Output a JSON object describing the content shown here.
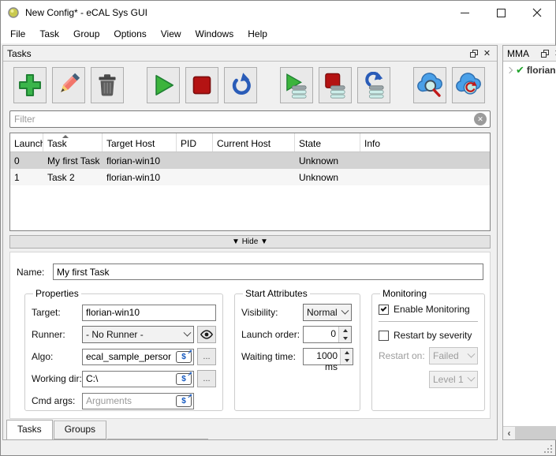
{
  "window": {
    "title": "New Config* - eCAL Sys GUI"
  },
  "menu": {
    "items": [
      "File",
      "Task",
      "Group",
      "Options",
      "View",
      "Windows",
      "Help"
    ]
  },
  "glyphs": {
    "close": "✕",
    "clear": "✕",
    "check_mark": "✔",
    "scroll_left": "‹",
    "scroll_right": "›",
    "dollar": "$",
    "arrow_ne": "↗"
  },
  "tasks_panel": {
    "title": "Tasks",
    "toolbar": {
      "buttons": [
        "add-task",
        "edit-task",
        "delete-task",
        "start-task",
        "stop-task",
        "restart-task",
        "start-all-tasks",
        "stop-all-tasks",
        "restart-all-tasks",
        "cloud-search",
        "cloud-reload"
      ]
    },
    "filter": {
      "placeholder": "Filter"
    },
    "table": {
      "columns": [
        "Launch",
        "Task",
        "Target Host",
        "PID",
        "Current Host",
        "State",
        "Info"
      ],
      "sort_column": "Task",
      "sort_order": "ascending",
      "rows": [
        {
          "launch": "0",
          "task": "My first Task",
          "target_host": "florian-win10",
          "pid": "",
          "current_host": "",
          "state": "Unknown",
          "info": "",
          "selected": true
        },
        {
          "launch": "1",
          "task": "Task 2",
          "target_host": "florian-win10",
          "pid": "",
          "current_host": "",
          "state": "Unknown",
          "info": "",
          "selected": false
        }
      ]
    },
    "hide_button": "▼ Hide ▼",
    "editor": {
      "name_label": "Name:",
      "name_value": "My first Task",
      "properties": {
        "title": "Properties",
        "target_label": "Target:",
        "target_value": "florian-win10",
        "runner_label": "Runner:",
        "runner_value": "- No Runner -",
        "algo_label": "Algo:",
        "algo_value": "ecal_sample_person_snd",
        "workdir_label": "Working dir:",
        "workdir_value": "C:\\",
        "cmdargs_label": "Cmd args:",
        "cmdargs_placeholder": "Arguments",
        "browse_label": "..."
      },
      "start_attributes": {
        "title": "Start Attributes",
        "visibility_label": "Visibility:",
        "visibility_value": "Normal",
        "launch_order_label": "Launch order:",
        "launch_order_value": "0",
        "waiting_time_label": "Waiting time:",
        "waiting_time_value": "1000 ms"
      },
      "monitoring": {
        "title": "Monitoring",
        "enable_label": "Enable Monitoring",
        "enable_checked": true,
        "restart_label": "Restart by severity",
        "restart_checked": false,
        "restart_on_label": "Restart on:",
        "restart_on_value": "Failed",
        "restart_level_value": "Level 1"
      }
    },
    "tabs": [
      {
        "label": "Tasks",
        "active": true
      },
      {
        "label": "Groups",
        "active": false
      }
    ]
  },
  "mma_panel": {
    "title": "MMA",
    "items": [
      {
        "label": "florian",
        "status": "ok"
      }
    ]
  },
  "colors": {
    "accent_green": "#3ab54a",
    "stop_red": "#b41313",
    "restart_blue": "#2a5cb8",
    "cloud_blue": "#4aa0e8",
    "selection_gray": "#d3d3d3"
  }
}
